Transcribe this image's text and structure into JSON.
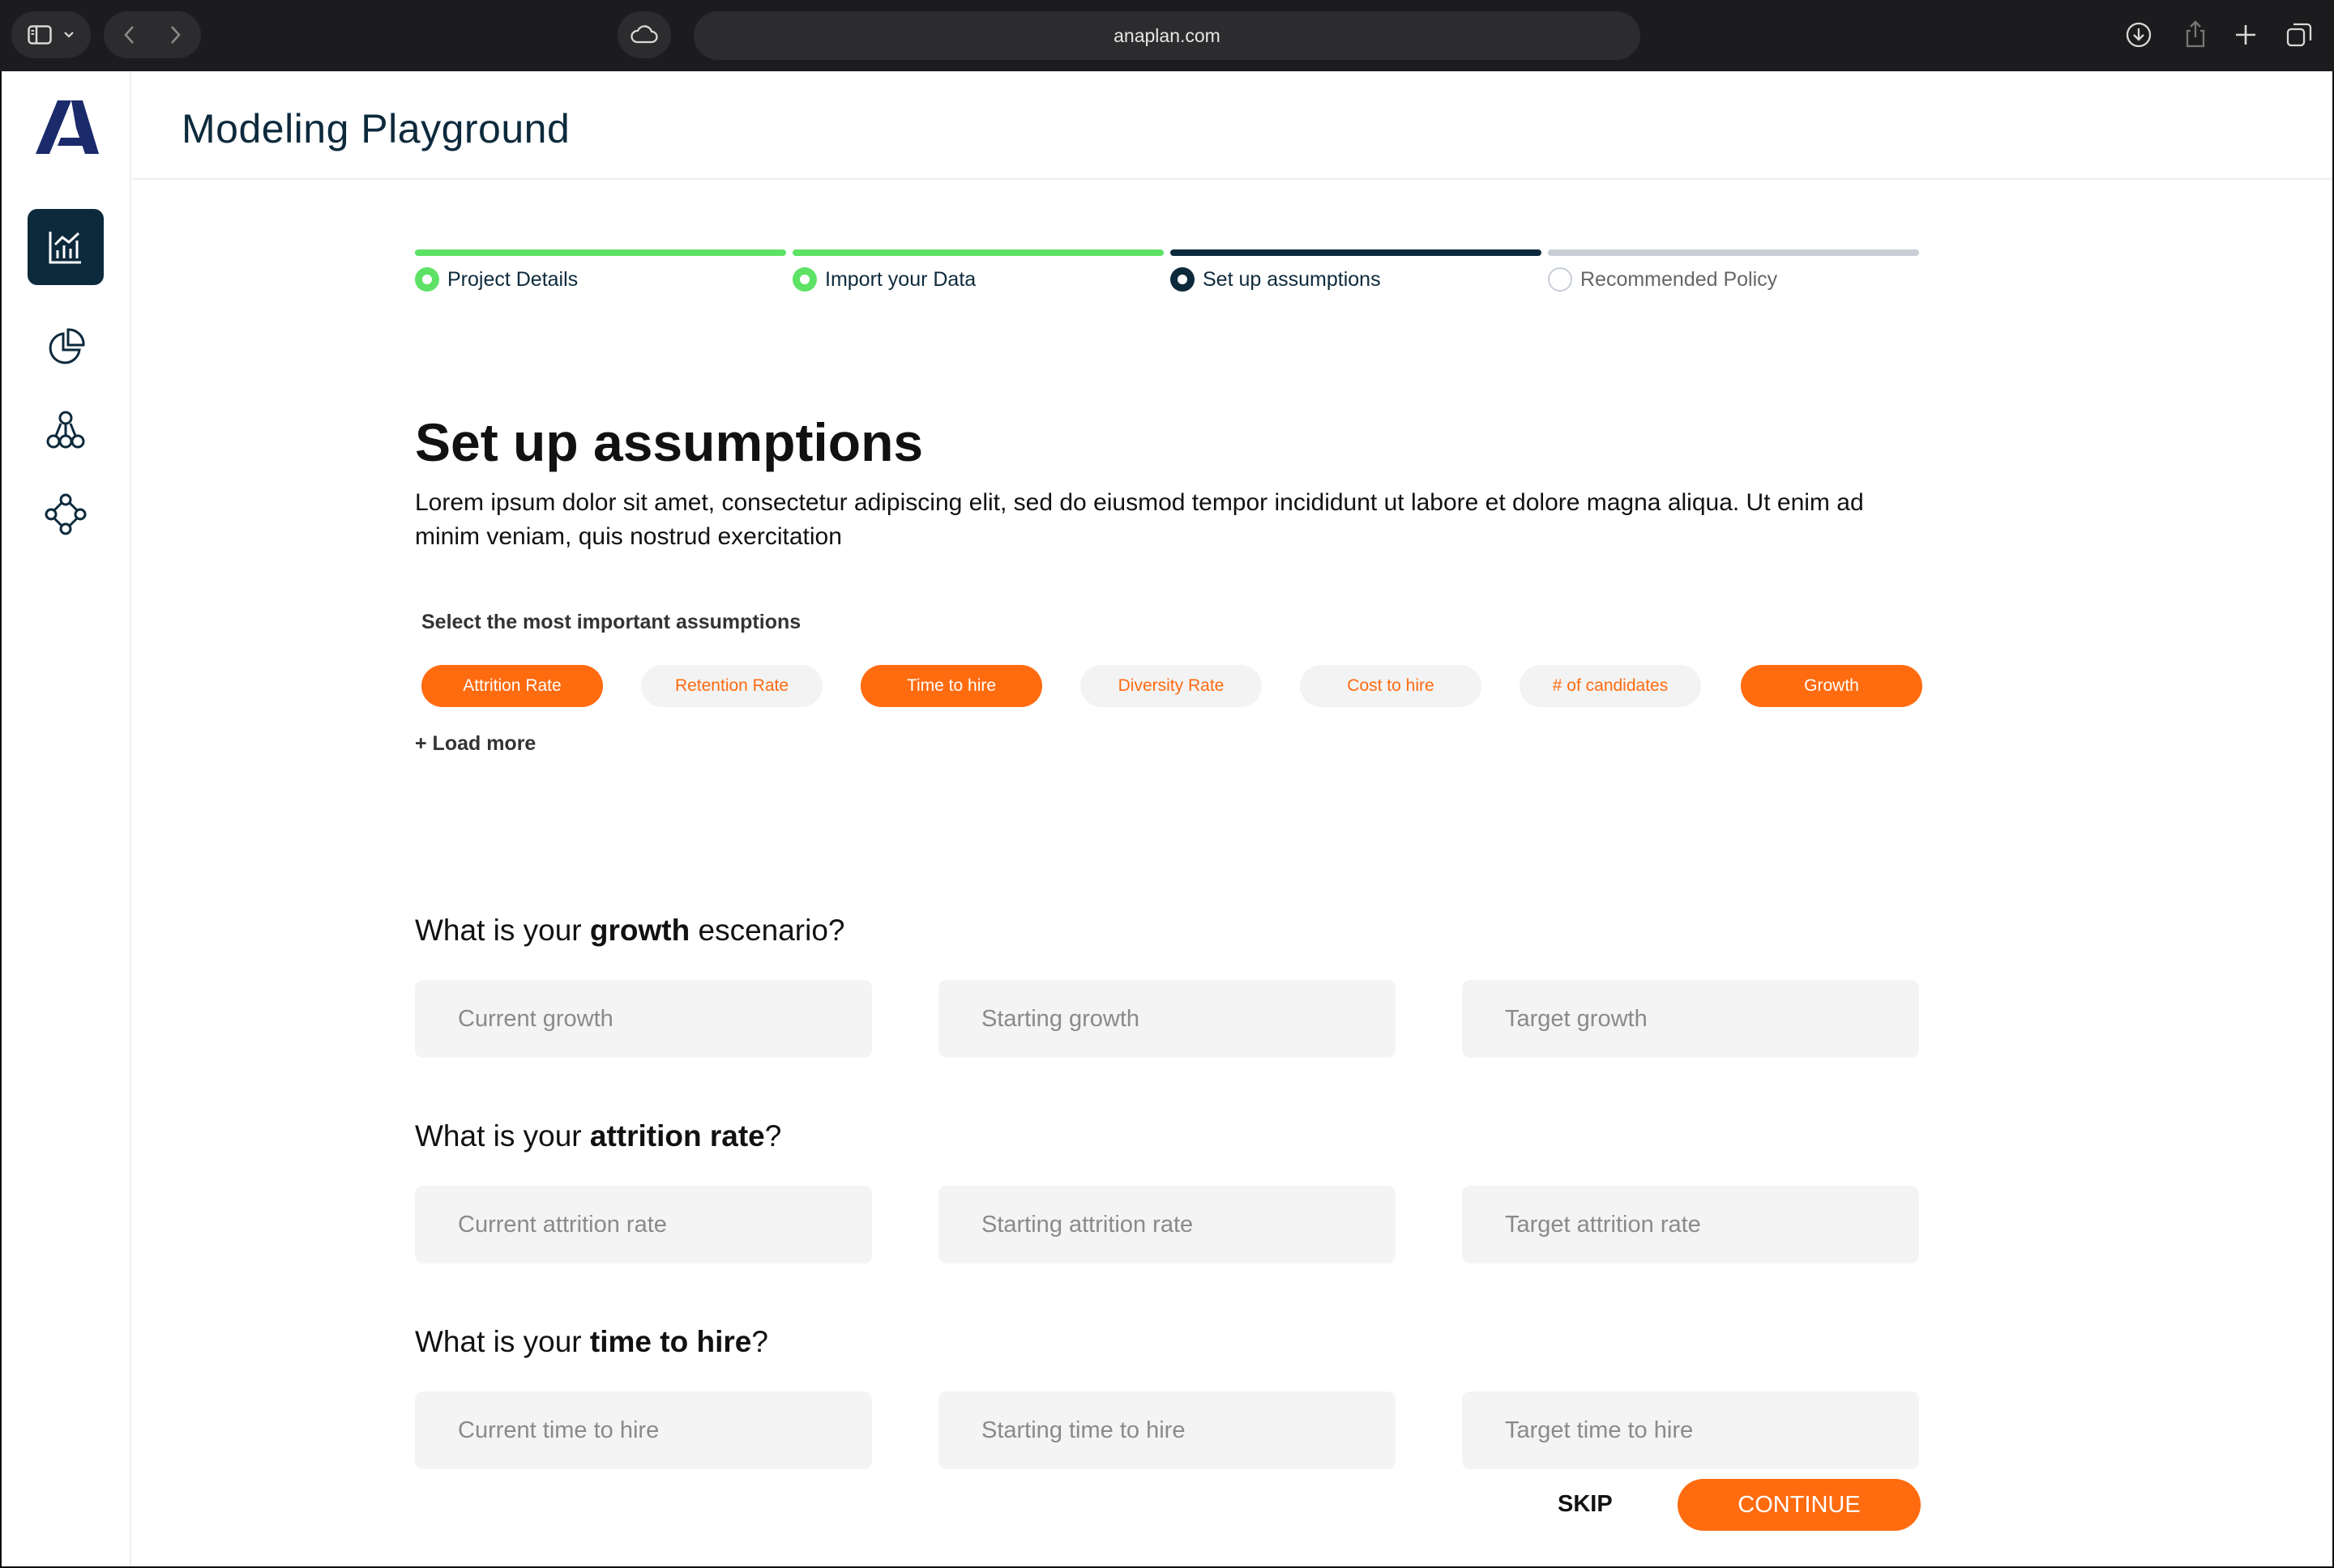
{
  "browser": {
    "url": "anaplan.com"
  },
  "app": {
    "title": "Modeling Playground"
  },
  "sidebar": {
    "items": [
      {
        "icon": "analytics-chart-icon",
        "active": true
      },
      {
        "icon": "pie-chart-icon",
        "active": false
      },
      {
        "icon": "hierarchy-icon",
        "active": false
      },
      {
        "icon": "network-icon",
        "active": false
      }
    ]
  },
  "steps": [
    {
      "label": "Project Details",
      "status": "complete"
    },
    {
      "label": "Import your Data",
      "status": "complete"
    },
    {
      "label": "Set up assumptions",
      "status": "current"
    },
    {
      "label": "Recommended Policy",
      "status": "upcoming"
    }
  ],
  "main": {
    "heading": "Set up assumptions",
    "description": "Lorem ipsum dolor sit amet, consectetur adipiscing elit, sed do eiusmod tempor incididunt ut labore et dolore magna aliqua. Ut enim ad minim veniam, quis nostrud exercitation",
    "select_label": "Select the most important assumptions",
    "chips": [
      {
        "label": "Attrition Rate",
        "selected": true
      },
      {
        "label": "Retention Rate",
        "selected": false
      },
      {
        "label": "Time to hire",
        "selected": true
      },
      {
        "label": "Diversity Rate",
        "selected": false
      },
      {
        "label": "Cost to hire",
        "selected": false
      },
      {
        "label": "# of candidates",
        "selected": false
      },
      {
        "label": "Growth",
        "selected": true
      }
    ],
    "load_more": "+ Load more",
    "questions": [
      {
        "prefix": "What is your ",
        "bold": "growth",
        "suffix": " escenario?",
        "fields": [
          "Current growth",
          "Starting growth",
          "Target growth"
        ]
      },
      {
        "prefix": "What is your ",
        "bold": "attrition rate",
        "suffix": "?",
        "fields": [
          "Current attrition rate",
          "Starting attrition rate",
          "Target attrition rate"
        ]
      },
      {
        "prefix": "What is your ",
        "bold": "time to hire",
        "suffix": "?",
        "fields": [
          "Current time to hire",
          "Starting time to hire",
          "Target time to hire"
        ]
      }
    ],
    "skip_label": "SKIP",
    "continue_label": "CONTINUE"
  },
  "colors": {
    "accent": "#ff6b0f",
    "navy": "#0d2a3c",
    "complete": "#5ee266",
    "upcoming": "#c8ced6"
  }
}
